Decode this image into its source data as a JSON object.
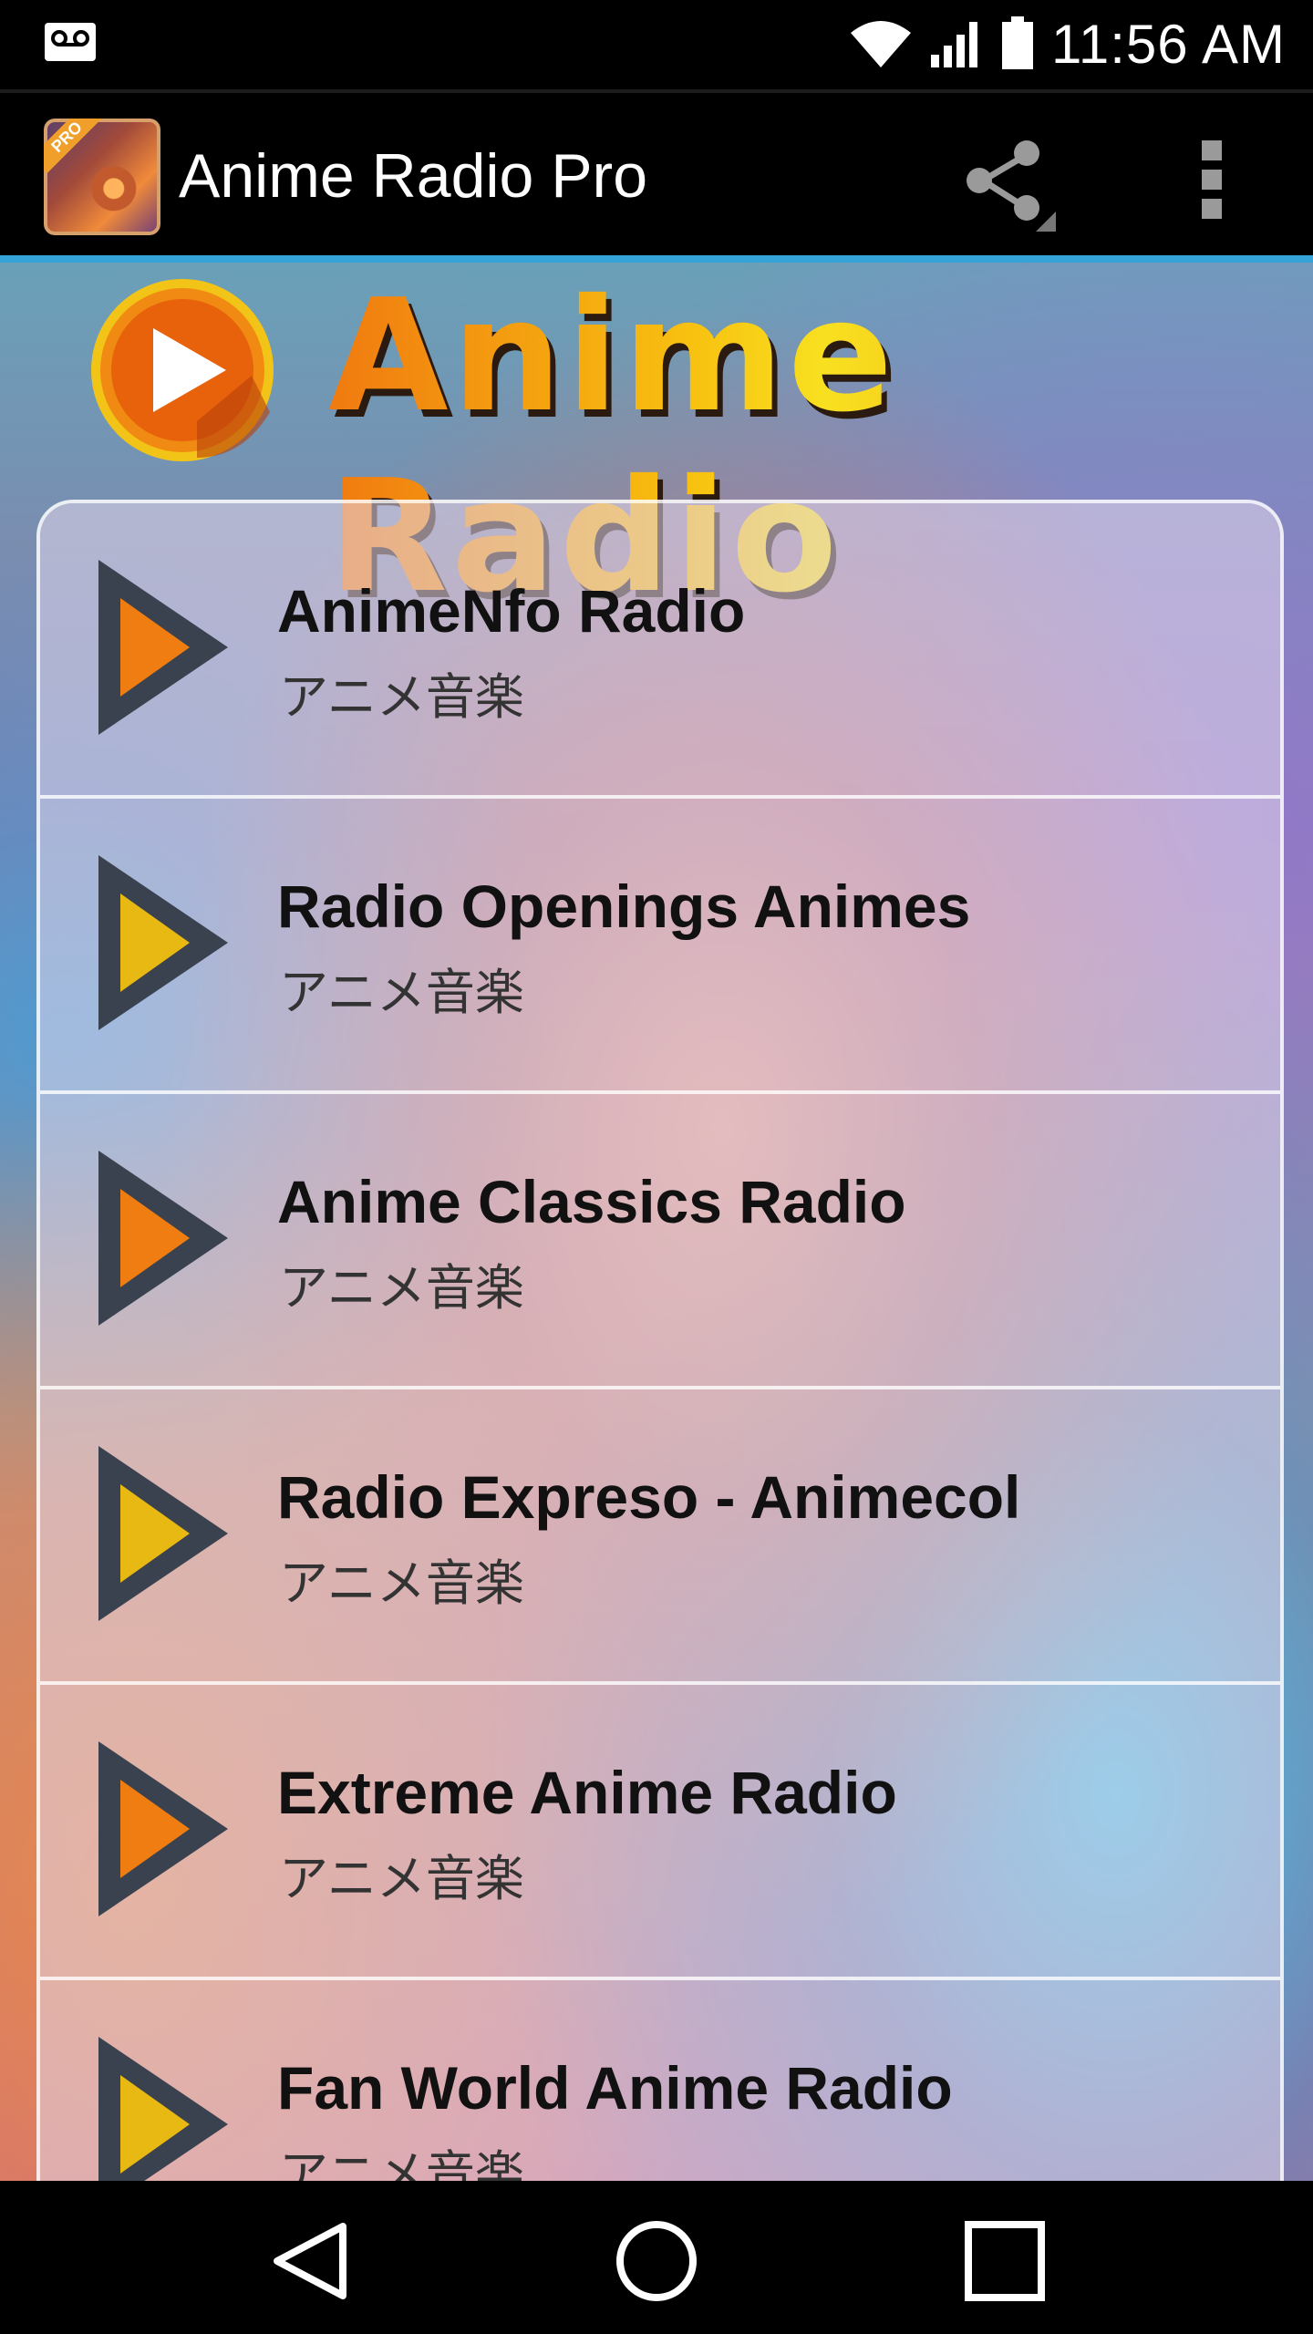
{
  "status_bar": {
    "time": "11:56 AM",
    "icons": [
      "voicemail-icon",
      "wifi-icon",
      "signal-icon",
      "battery-icon"
    ]
  },
  "action_bar": {
    "title": "Anime Radio Pro",
    "app_icon_badge": "PRO",
    "actions": [
      "share-icon",
      "overflow-menu-icon"
    ]
  },
  "banner": {
    "text": "Anime Radio"
  },
  "stations": [
    {
      "name": "AnimeNfo Radio",
      "subtitle": "アニメ音楽",
      "arrow_color": "#ef7d12"
    },
    {
      "name": "Radio Openings Animes",
      "subtitle": "アニメ音楽",
      "arrow_color": "#e8b813"
    },
    {
      "name": "Anime Classics Radio",
      "subtitle": "アニメ音楽",
      "arrow_color": "#ef7d12"
    },
    {
      "name": "Radio Expreso - Animecol",
      "subtitle": "アニメ音楽",
      "arrow_color": "#e8b813"
    },
    {
      "name": "Extreme Anime Radio",
      "subtitle": "アニメ音楽",
      "arrow_color": "#ef7d12"
    },
    {
      "name": "Fan World Anime Radio",
      "subtitle": "アニメ音楽",
      "arrow_color": "#e8b813"
    }
  ],
  "nav_bar": {
    "buttons": [
      "back-icon",
      "home-icon",
      "recents-icon"
    ]
  },
  "colors": {
    "accent": "#34a3d8",
    "arrow_border": "#3a4250",
    "orange": "#ef7d12",
    "yellow": "#e8b813"
  }
}
